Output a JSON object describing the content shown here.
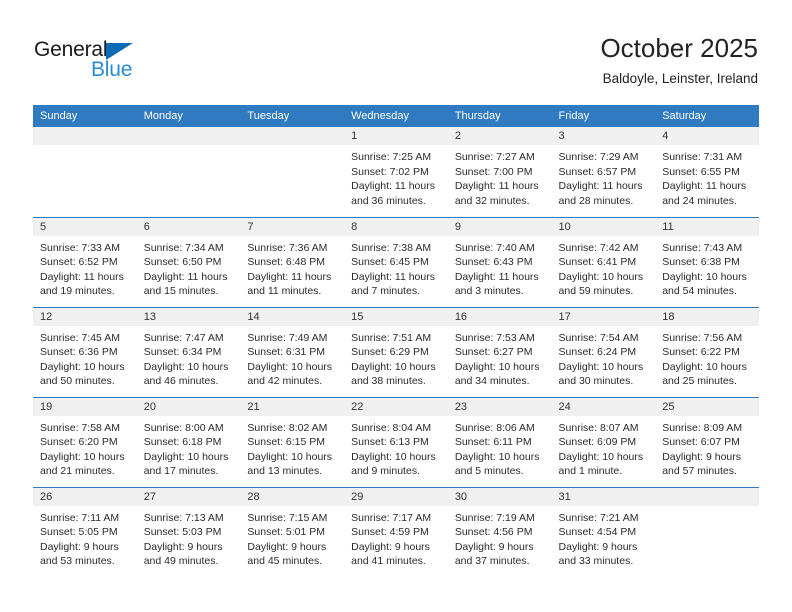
{
  "brand": {
    "name_primary": "General",
    "name_secondary": "Blue",
    "triangle_icon": "triangle-icon",
    "color_primary": "#1a1a1a",
    "color_secondary": "#2a8bd5",
    "triangle_color": "#0d6ab5"
  },
  "header": {
    "title": "October 2025",
    "subtitle": "Baldoyle, Leinster, Ireland"
  },
  "theme": {
    "header_bg": "#2f7ac0",
    "header_text": "#ffffff",
    "daynum_bg": "#f0f0f0",
    "row_border": "#2f7ac0",
    "cell_text": "#2b2b2b"
  },
  "weekdays": [
    "Sunday",
    "Monday",
    "Tuesday",
    "Wednesday",
    "Thursday",
    "Friday",
    "Saturday"
  ],
  "weeks": [
    [
      {
        "day": "",
        "lines": []
      },
      {
        "day": "",
        "lines": []
      },
      {
        "day": "",
        "lines": []
      },
      {
        "day": "1",
        "lines": [
          "Sunrise: 7:25 AM",
          "Sunset: 7:02 PM",
          "Daylight: 11 hours",
          "and 36 minutes."
        ]
      },
      {
        "day": "2",
        "lines": [
          "Sunrise: 7:27 AM",
          "Sunset: 7:00 PM",
          "Daylight: 11 hours",
          "and 32 minutes."
        ]
      },
      {
        "day": "3",
        "lines": [
          "Sunrise: 7:29 AM",
          "Sunset: 6:57 PM",
          "Daylight: 11 hours",
          "and 28 minutes."
        ]
      },
      {
        "day": "4",
        "lines": [
          "Sunrise: 7:31 AM",
          "Sunset: 6:55 PM",
          "Daylight: 11 hours",
          "and 24 minutes."
        ]
      }
    ],
    [
      {
        "day": "5",
        "lines": [
          "Sunrise: 7:33 AM",
          "Sunset: 6:52 PM",
          "Daylight: 11 hours",
          "and 19 minutes."
        ]
      },
      {
        "day": "6",
        "lines": [
          "Sunrise: 7:34 AM",
          "Sunset: 6:50 PM",
          "Daylight: 11 hours",
          "and 15 minutes."
        ]
      },
      {
        "day": "7",
        "lines": [
          "Sunrise: 7:36 AM",
          "Sunset: 6:48 PM",
          "Daylight: 11 hours",
          "and 11 minutes."
        ]
      },
      {
        "day": "8",
        "lines": [
          "Sunrise: 7:38 AM",
          "Sunset: 6:45 PM",
          "Daylight: 11 hours",
          "and 7 minutes."
        ]
      },
      {
        "day": "9",
        "lines": [
          "Sunrise: 7:40 AM",
          "Sunset: 6:43 PM",
          "Daylight: 11 hours",
          "and 3 minutes."
        ]
      },
      {
        "day": "10",
        "lines": [
          "Sunrise: 7:42 AM",
          "Sunset: 6:41 PM",
          "Daylight: 10 hours",
          "and 59 minutes."
        ]
      },
      {
        "day": "11",
        "lines": [
          "Sunrise: 7:43 AM",
          "Sunset: 6:38 PM",
          "Daylight: 10 hours",
          "and 54 minutes."
        ]
      }
    ],
    [
      {
        "day": "12",
        "lines": [
          "Sunrise: 7:45 AM",
          "Sunset: 6:36 PM",
          "Daylight: 10 hours",
          "and 50 minutes."
        ]
      },
      {
        "day": "13",
        "lines": [
          "Sunrise: 7:47 AM",
          "Sunset: 6:34 PM",
          "Daylight: 10 hours",
          "and 46 minutes."
        ]
      },
      {
        "day": "14",
        "lines": [
          "Sunrise: 7:49 AM",
          "Sunset: 6:31 PM",
          "Daylight: 10 hours",
          "and 42 minutes."
        ]
      },
      {
        "day": "15",
        "lines": [
          "Sunrise: 7:51 AM",
          "Sunset: 6:29 PM",
          "Daylight: 10 hours",
          "and 38 minutes."
        ]
      },
      {
        "day": "16",
        "lines": [
          "Sunrise: 7:53 AM",
          "Sunset: 6:27 PM",
          "Daylight: 10 hours",
          "and 34 minutes."
        ]
      },
      {
        "day": "17",
        "lines": [
          "Sunrise: 7:54 AM",
          "Sunset: 6:24 PM",
          "Daylight: 10 hours",
          "and 30 minutes."
        ]
      },
      {
        "day": "18",
        "lines": [
          "Sunrise: 7:56 AM",
          "Sunset: 6:22 PM",
          "Daylight: 10 hours",
          "and 25 minutes."
        ]
      }
    ],
    [
      {
        "day": "19",
        "lines": [
          "Sunrise: 7:58 AM",
          "Sunset: 6:20 PM",
          "Daylight: 10 hours",
          "and 21 minutes."
        ]
      },
      {
        "day": "20",
        "lines": [
          "Sunrise: 8:00 AM",
          "Sunset: 6:18 PM",
          "Daylight: 10 hours",
          "and 17 minutes."
        ]
      },
      {
        "day": "21",
        "lines": [
          "Sunrise: 8:02 AM",
          "Sunset: 6:15 PM",
          "Daylight: 10 hours",
          "and 13 minutes."
        ]
      },
      {
        "day": "22",
        "lines": [
          "Sunrise: 8:04 AM",
          "Sunset: 6:13 PM",
          "Daylight: 10 hours",
          "and 9 minutes."
        ]
      },
      {
        "day": "23",
        "lines": [
          "Sunrise: 8:06 AM",
          "Sunset: 6:11 PM",
          "Daylight: 10 hours",
          "and 5 minutes."
        ]
      },
      {
        "day": "24",
        "lines": [
          "Sunrise: 8:07 AM",
          "Sunset: 6:09 PM",
          "Daylight: 10 hours",
          "and 1 minute."
        ]
      },
      {
        "day": "25",
        "lines": [
          "Sunrise: 8:09 AM",
          "Sunset: 6:07 PM",
          "Daylight: 9 hours",
          "and 57 minutes."
        ]
      }
    ],
    [
      {
        "day": "26",
        "lines": [
          "Sunrise: 7:11 AM",
          "Sunset: 5:05 PM",
          "Daylight: 9 hours",
          "and 53 minutes."
        ]
      },
      {
        "day": "27",
        "lines": [
          "Sunrise: 7:13 AM",
          "Sunset: 5:03 PM",
          "Daylight: 9 hours",
          "and 49 minutes."
        ]
      },
      {
        "day": "28",
        "lines": [
          "Sunrise: 7:15 AM",
          "Sunset: 5:01 PM",
          "Daylight: 9 hours",
          "and 45 minutes."
        ]
      },
      {
        "day": "29",
        "lines": [
          "Sunrise: 7:17 AM",
          "Sunset: 4:59 PM",
          "Daylight: 9 hours",
          "and 41 minutes."
        ]
      },
      {
        "day": "30",
        "lines": [
          "Sunrise: 7:19 AM",
          "Sunset: 4:56 PM",
          "Daylight: 9 hours",
          "and 37 minutes."
        ]
      },
      {
        "day": "31",
        "lines": [
          "Sunrise: 7:21 AM",
          "Sunset: 4:54 PM",
          "Daylight: 9 hours",
          "and 33 minutes."
        ]
      },
      {
        "day": "",
        "lines": []
      }
    ]
  ]
}
